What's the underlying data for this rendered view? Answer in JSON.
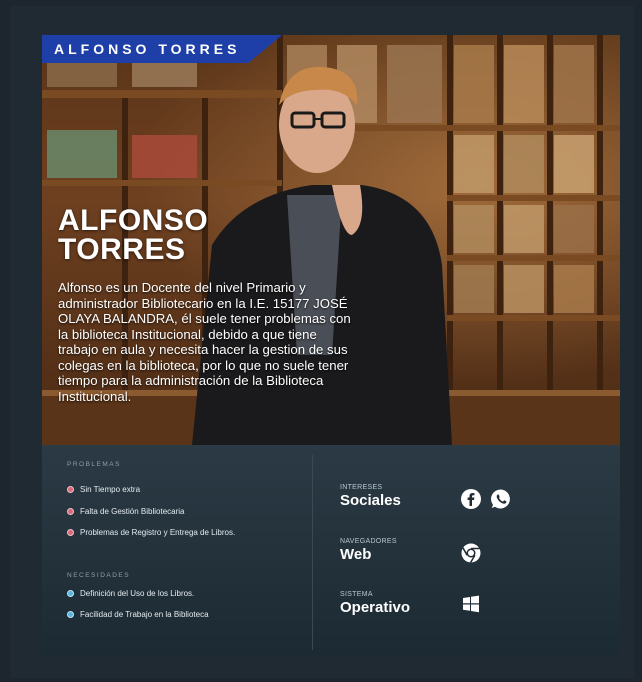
{
  "header": {
    "tag": "ALFONSO TORRES",
    "name_line1": "ALFONSO",
    "name_line2": "TORRES",
    "description": "Alfonso es un Docente del nivel Primario y administrador Bibliotecario en la I.E. 15177 JOSÉ OLAYA BALANDRA, él suele tener problemas con la biblioteca Institucional, debido a que tiene trabajo en aula y necesita hacer la gestion de sus colegas en la biblioteca, por lo que no suele tener tiempo para la administración de la Biblioteca Institucional."
  },
  "problems": {
    "label": "PROBLEMAS",
    "items": [
      "Sin Tiempo extra",
      "Falta de Gestión Bibliotecaria",
      "Problemas de Registro y Entrega de Libros."
    ]
  },
  "needs": {
    "label": "NECESIDADES",
    "items": [
      "Definición del Uso de los Libros.",
      "Facilidad de Trabajo en la Biblioteca"
    ]
  },
  "info": [
    {
      "small": "INTERESES",
      "big": "Sociales",
      "icons": [
        "facebook-icon",
        "whatsapp-icon"
      ]
    },
    {
      "small": "NAVEGADORES",
      "big": "Web",
      "icons": [
        "chrome-icon"
      ]
    },
    {
      "small": "SISTEMA",
      "big": "Operativo",
      "icons": [
        "windows-icon"
      ]
    }
  ],
  "colors": {
    "tag_blue": "#1f3fa8",
    "problem_dot": "#d66a7a",
    "need_dot": "#59b6df"
  }
}
